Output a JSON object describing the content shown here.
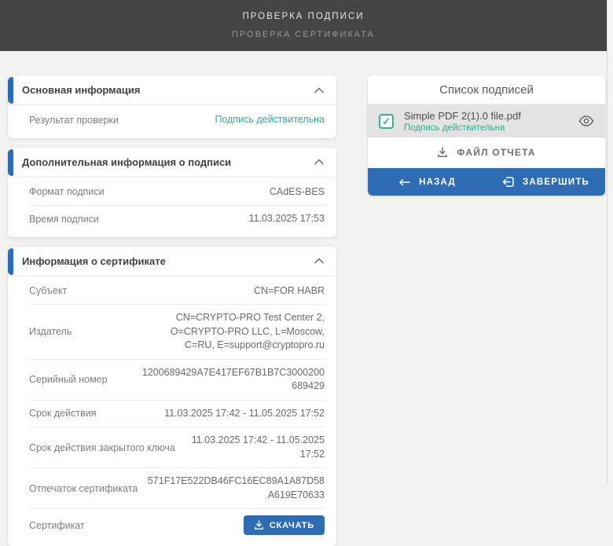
{
  "header": {
    "title": "ПРОВЕРКА ПОДПИСИ",
    "subtitle": "ПРОВЕРКА СЕРТИФИКАТА"
  },
  "cards": {
    "basic": {
      "title": "Основная информация",
      "rows": [
        {
          "label": "Результат проверки",
          "value": "Подпись действительна"
        }
      ]
    },
    "signature_info": {
      "title": "Дополнительная информация о подписи",
      "rows": [
        {
          "label": "Формат подписи",
          "value": "CAdES-BES"
        },
        {
          "label": "Время подписи",
          "value": "11.03.2025 17:53"
        }
      ]
    },
    "certificate": {
      "title": "Информация о сертификате",
      "rows": [
        {
          "label": "Субъект",
          "value": "CN=FOR HABR"
        },
        {
          "label": "Издатель",
          "value": "CN=CRYPTO-PRO Test Center 2, O=CRYPTO-PRO LLC, L=Moscow, C=RU, E=support@cryptopro.ru"
        },
        {
          "label": "Серийный номер",
          "value": "1200689429A7E417EF67B1B7C3000200689429"
        },
        {
          "label": "Срок действия",
          "value": "11.03.2025 17:42 - 11.05.2025 17:52"
        },
        {
          "label": "Срок действия закрытого ключа",
          "value": "11.03.2025 17:42 - 11.05.2025 17:52"
        },
        {
          "label": "Отпечаток сертификата",
          "value": "571F17E522DB46FC16EC89A1A87D58A619E70633"
        },
        {
          "label": "Сертификат",
          "value": ""
        }
      ],
      "download_button": "СКАЧАТЬ"
    }
  },
  "signatures_panel": {
    "title": "Список подписей",
    "item": {
      "filename": "Simple PDF 2(1).0 file.pdf",
      "status": "Подпись действительна",
      "checkmark": "✓"
    },
    "report_button": "ФАЙЛ ОТЧЕТА",
    "back_button": "НАЗАД",
    "finish_button": "ЗАВЕРШИТЬ"
  },
  "colors": {
    "accent_blue": "#2e6db4",
    "success_green": "#2fae8a",
    "header_bg": "#454545",
    "item_bg": "#e3e3e3"
  }
}
